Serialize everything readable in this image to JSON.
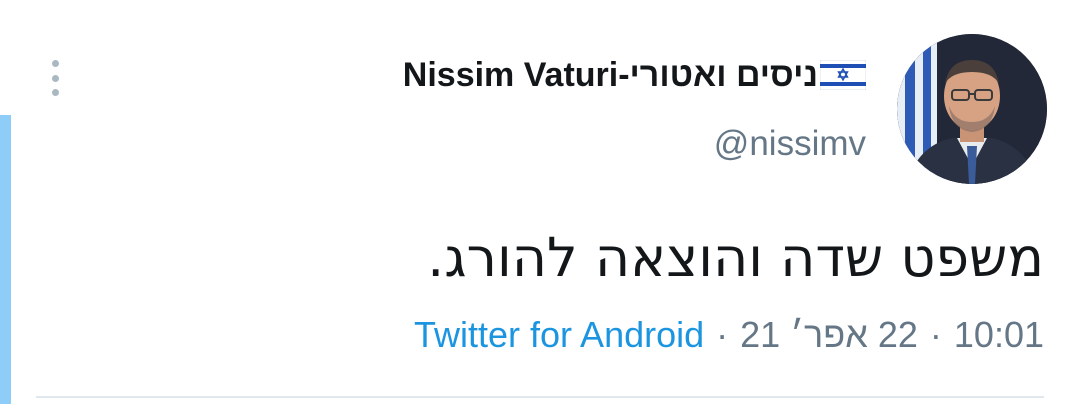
{
  "tweet": {
    "display_name": "Nissim Vaturi-ניסים ואטורי",
    "handle": "@nissimv",
    "text": "משפט שדה והוצאה להורג.",
    "time": "10:01",
    "date": "22 אפר׳ 21",
    "source": "Twitter for Android",
    "separator": "·"
  },
  "icons": {
    "more": "more-vertical-icon",
    "flag": "israel-flag-icon",
    "avatar": "profile-photo"
  },
  "colors": {
    "name": "#14171a",
    "secondary": "#657786",
    "link": "#1b95e0",
    "thread_bar": "#8ecdf7",
    "divider": "#e1e8ed"
  }
}
